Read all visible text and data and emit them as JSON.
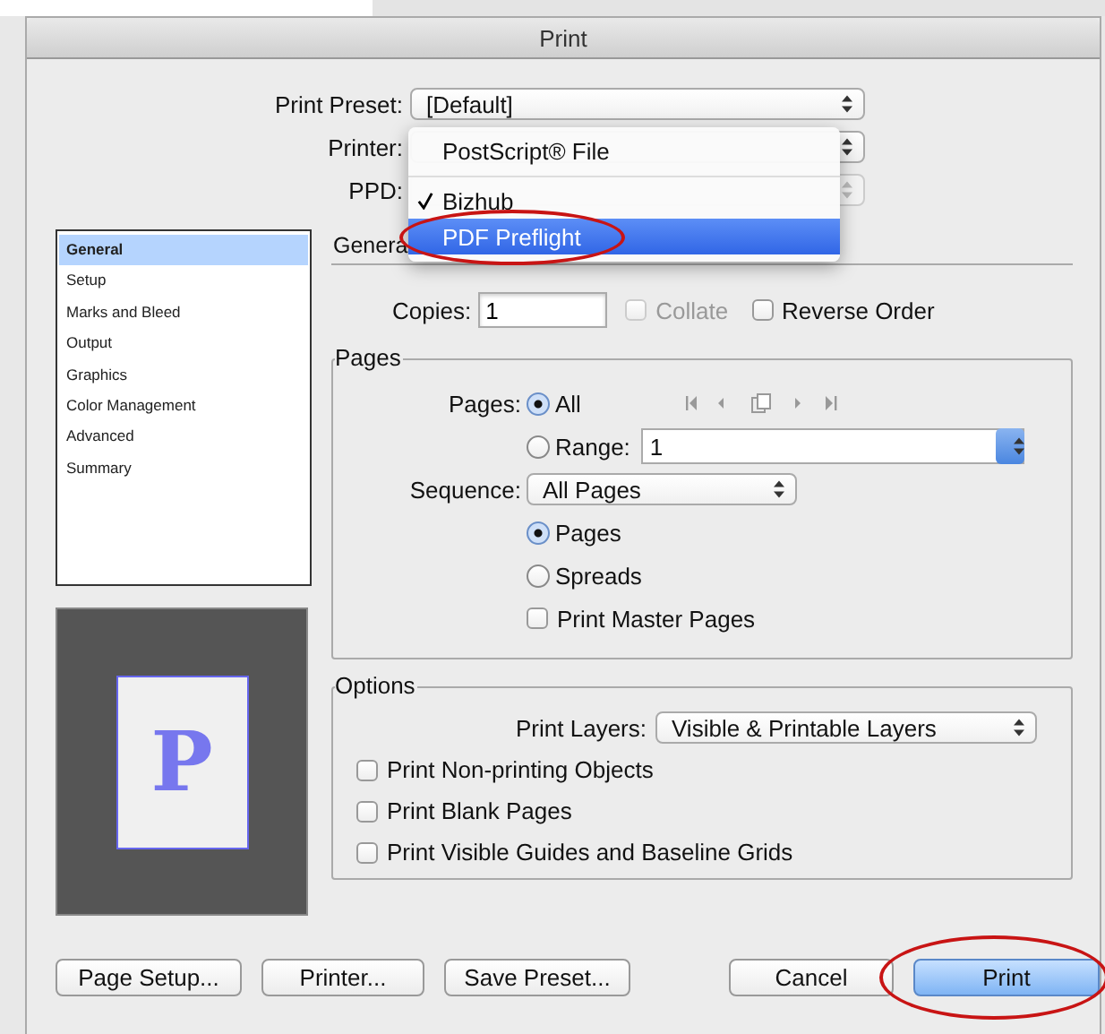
{
  "window": {
    "title": "Print"
  },
  "preset_form": {
    "print_preset": {
      "label": "Print Preset:",
      "value": "[Default]"
    },
    "printer": {
      "label": "Printer:"
    },
    "ppd": {
      "label": "PPD:",
      "disabled": true
    }
  },
  "printer_menu": {
    "items": [
      {
        "label": "PostScript® File",
        "checked": false,
        "selected": false,
        "circled": false
      },
      {
        "label": "Bizhub",
        "checked": true,
        "selected": false,
        "circled": false
      },
      {
        "label": "PDF Preflight",
        "checked": false,
        "selected": true,
        "circled": true
      }
    ]
  },
  "sidebar": {
    "items": [
      {
        "label": "General",
        "selected": true
      },
      {
        "label": "Setup",
        "selected": false
      },
      {
        "label": "Marks and Bleed",
        "selected": false
      },
      {
        "label": "Output",
        "selected": false
      },
      {
        "label": "Graphics",
        "selected": false
      },
      {
        "label": "Color Management",
        "selected": false
      },
      {
        "label": "Advanced",
        "selected": false
      },
      {
        "label": "Summary",
        "selected": false
      }
    ]
  },
  "preview": {
    "letter": "P"
  },
  "panel": {
    "heading": "Genera",
    "copies": {
      "label": "Copies:",
      "value": "1"
    },
    "checks": [
      {
        "label": "Collate",
        "checked": false,
        "disabled": true
      },
      {
        "label": "Reverse Order",
        "checked": false,
        "disabled": false
      }
    ],
    "pages_group": {
      "title": "Pages",
      "pages_label": "Pages:",
      "page_options": [
        {
          "label": "All",
          "selected": true
        },
        {
          "label": "Range:",
          "selected": false
        }
      ],
      "range_value": "1",
      "sequence": {
        "label": "Sequence:",
        "value": "All Pages"
      },
      "layout_options": [
        {
          "label": "Pages",
          "selected": true
        },
        {
          "label": "Spreads",
          "selected": false
        }
      ],
      "print_master_pages": {
        "label": "Print Master Pages",
        "checked": false
      }
    },
    "options_group": {
      "title": "Options",
      "print_layers": {
        "label": "Print Layers:",
        "value": "Visible & Printable Layers"
      },
      "checks": [
        {
          "label": "Print Non-printing Objects",
          "checked": false
        },
        {
          "label": "Print Blank Pages",
          "checked": false
        },
        {
          "label": "Print Visible Guides and Baseline Grids",
          "checked": false
        }
      ]
    }
  },
  "buttons": [
    {
      "label": "Page Setup...",
      "default": false,
      "circled": false
    },
    {
      "label": "Printer...",
      "default": false,
      "circled": false
    },
    {
      "label": "Save Preset...",
      "default": false,
      "circled": false
    },
    {
      "label": "Cancel",
      "default": false,
      "circled": false
    },
    {
      "label": "Print",
      "default": true,
      "circled": true
    }
  ]
}
